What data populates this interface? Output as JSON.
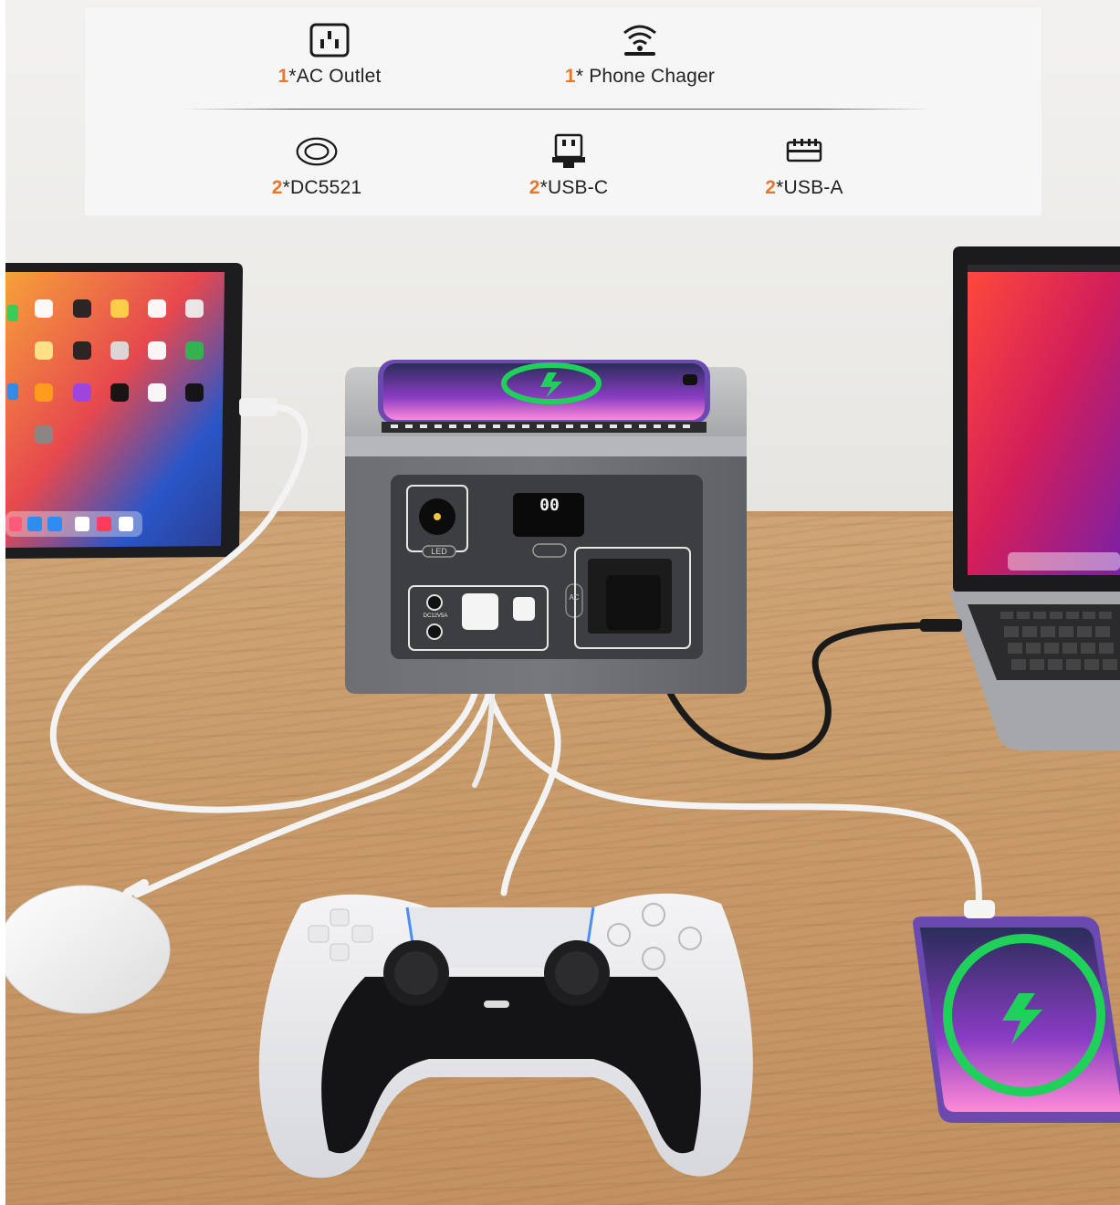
{
  "spec_panel": {
    "ports": [
      {
        "icon": "ac-outlet-icon",
        "count": "1",
        "label": "*AC Outlet"
      },
      {
        "icon": "wireless-charger-icon",
        "count": "1",
        "label": "* Phone Chager"
      },
      {
        "icon": "dc5521-port-icon",
        "count": "2",
        "label": "*DC5521"
      },
      {
        "icon": "usb-c-port-icon",
        "count": "2",
        "label": "*USB-C"
      },
      {
        "icon": "usb-a-port-icon",
        "count": "2",
        "label": "*USB-A"
      }
    ]
  },
  "power_station": {
    "display_readout": "00",
    "led_button_label": "LED",
    "dc_port_label": "DC12V5A",
    "ac_label": "AC"
  },
  "colors": {
    "accent": "#e8762b",
    "charge_ring": "#1fd05a",
    "station_body": "#6b6c70",
    "station_panel": "#3a3b3e"
  }
}
